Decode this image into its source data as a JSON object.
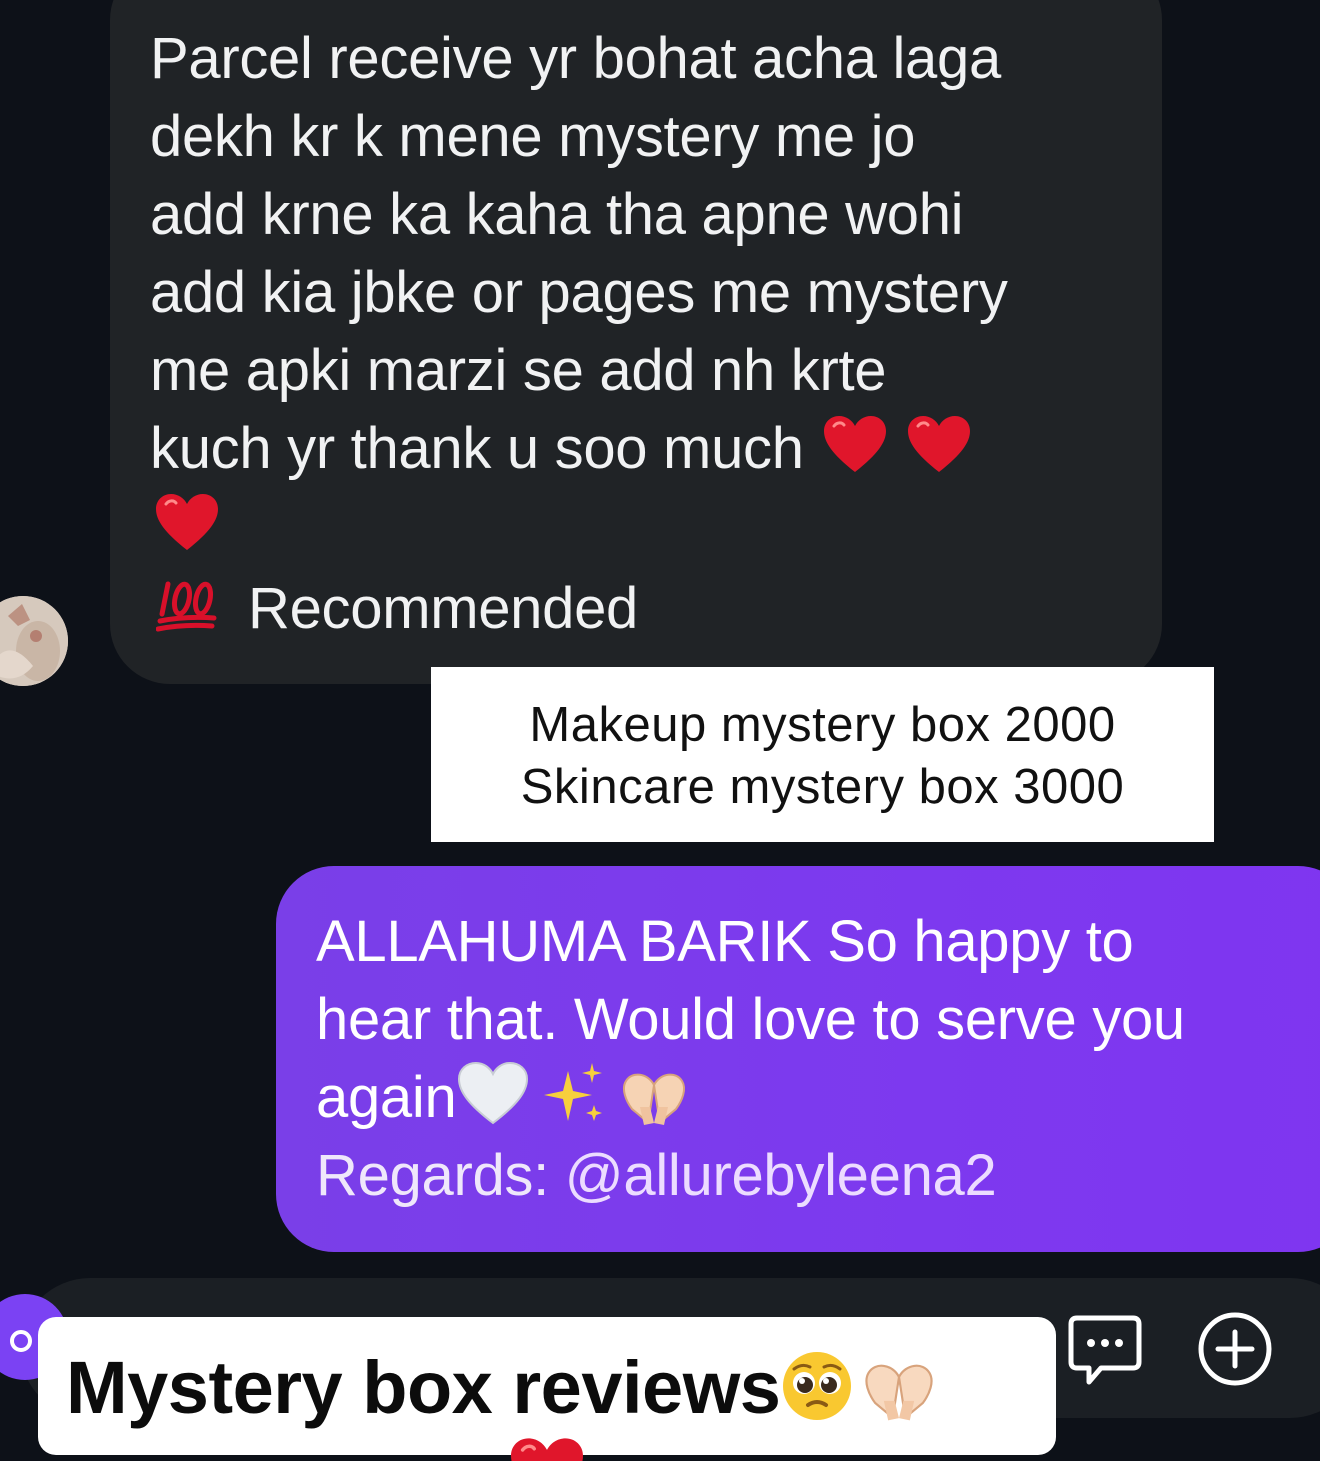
{
  "incoming_message": {
    "lines": [
      "Parcel receive yr bohat acha laga",
      "dekh kr k mene mystery me jo",
      "add krne ka kaha tha apne wohi",
      "add kia jbke or pages me mystery",
      "me apki marzi se add nh krte",
      "kuch yr thank u soo much"
    ],
    "recommended": "Recommended",
    "icons": [
      "red-heart-icon",
      "red-heart-icon",
      "red-heart-icon",
      "hundred-points-icon"
    ]
  },
  "sender_avatar": {
    "icon": "avatar"
  },
  "price_card": {
    "makeup": "Makeup mystery box 2000",
    "skincare": "Skincare mystery box 3000"
  },
  "outgoing_message": {
    "line1": "ALLAHUMA BARIK So happy to",
    "line2": "hear that. Would love to serve you",
    "line3": "again",
    "regards_label": "Regards:",
    "mention": "@allurebyleena2",
    "icons": [
      "white-heart-icon",
      "sparkles-icon",
      "heart-hands-icon"
    ]
  },
  "composer": {
    "icons": [
      "camera-icon",
      "chat-bubble-icon",
      "plus-icon"
    ]
  },
  "overlay_title": {
    "text": "Mystery box reviews",
    "icons": [
      "pleading-face-icon",
      "heart-hands-icon"
    ]
  },
  "colors": {
    "background": "#0d1118",
    "incoming_bubble": "#202326",
    "outgoing_bubble": "#7d39ef",
    "heart_red": "#e0162b"
  }
}
